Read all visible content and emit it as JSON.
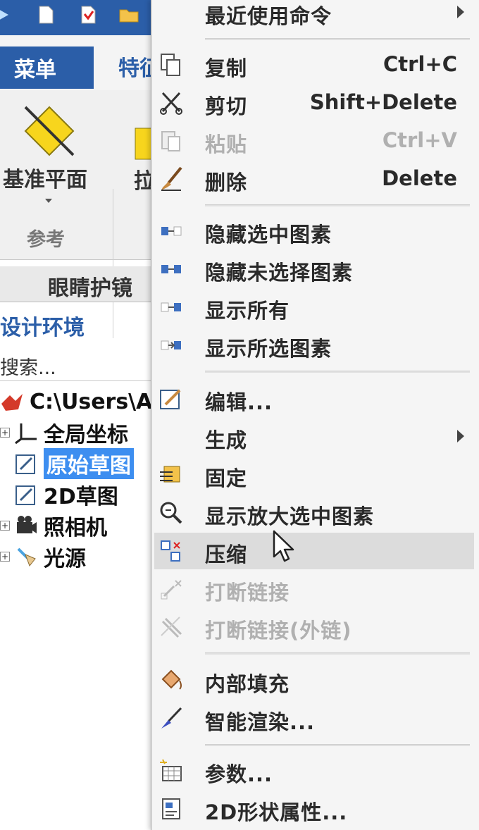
{
  "app": {
    "ribbon_tabs": [
      "菜单",
      "特征"
    ],
    "plane_button": "基准平面",
    "group_label": "参考",
    "plane_button_right": "拉",
    "panel_tab": "眼睛护镜",
    "env_label": "设计环境",
    "search_placeholder": "搜索...",
    "tree": [
      {
        "label": "C:\\Users\\A",
        "icon": "scene-icon"
      },
      {
        "label": "全局坐标",
        "icon": "axes-icon"
      },
      {
        "label": "原始草图",
        "icon": "sketch-icon",
        "selected": true
      },
      {
        "label": "2D草图",
        "icon": "sketch-icon"
      },
      {
        "label": "照相机",
        "icon": "camera-icon"
      },
      {
        "label": "光源",
        "icon": "light-icon"
      }
    ]
  },
  "menu": {
    "items": [
      {
        "label": "最近使用命令",
        "submenu": true
      },
      {
        "label": "复制",
        "shortcut": "Ctrl+C",
        "icon": "copy-icon"
      },
      {
        "label": "剪切",
        "shortcut": "Shift+Delete",
        "icon": "scissors-icon"
      },
      {
        "label": "粘贴",
        "shortcut": "Ctrl+V",
        "icon": "paste-icon",
        "disabled": true
      },
      {
        "label": "删除",
        "shortcut": "Delete",
        "icon": "brush-delete-icon"
      },
      {
        "label": "隐藏选中图素",
        "icon": "hide-selected-icon"
      },
      {
        "label": "隐藏未选择图素",
        "icon": "hide-unselected-icon"
      },
      {
        "label": "显示所有",
        "icon": "show-all-icon"
      },
      {
        "label": "显示所选图素",
        "icon": "show-selected-icon"
      },
      {
        "label": "编辑...",
        "icon": "edit-icon"
      },
      {
        "label": "生成",
        "submenu": true
      },
      {
        "label": "固定",
        "icon": "fix-icon"
      },
      {
        "label": "显示放大选中图素",
        "icon": "zoom-icon"
      },
      {
        "label": "压缩",
        "icon": "compress-icon",
        "hover": true
      },
      {
        "label": "打断链接",
        "icon": "break-link-icon",
        "disabled": true
      },
      {
        "label": "打断链接(外链)",
        "icon": "break-external-link-icon",
        "disabled": true
      },
      {
        "label": "内部填充",
        "icon": "fill-icon"
      },
      {
        "label": "智能渲染...",
        "icon": "render-icon"
      },
      {
        "label": "参数...",
        "icon": "parameters-icon"
      },
      {
        "label": "2D形状属性...",
        "icon": "shape-properties-icon"
      }
    ]
  },
  "colors": {
    "accent": "#2b5ea8",
    "selection": "#3d8ef0",
    "menu_bg": "#f5f5f5",
    "hover": "#dcdcdc",
    "disabled": "#b0b0b0"
  }
}
